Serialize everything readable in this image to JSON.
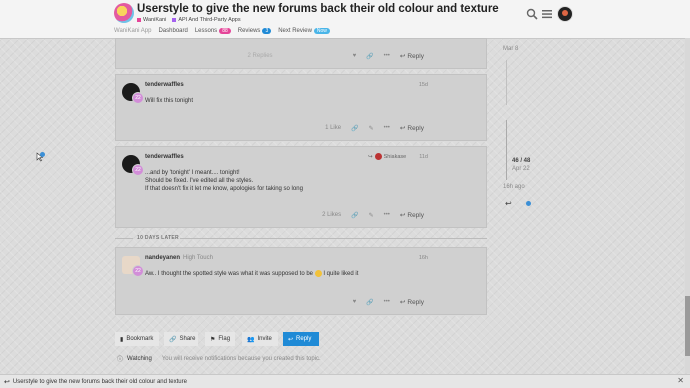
{
  "header": {
    "title": "Userstyle to give the new forums back their old colour and texture",
    "categories": [
      {
        "label": "WaniKani",
        "color": "#e54599"
      },
      {
        "label": "API And Third-Party Apps",
        "color": "#a461ef"
      }
    ],
    "nav": {
      "app": "WaniKani App",
      "dashboard": "Dashboard",
      "lessons": "Lessons",
      "lessons_count": "88",
      "reviews": "Reviews",
      "reviews_count": "3",
      "next_review": "Next Review",
      "next_review_badge": "Now"
    }
  },
  "posts": [
    {
      "actions": {
        "replies": "2 Replies",
        "reply": "Reply"
      }
    },
    {
      "username": "tenderwaffles",
      "level": "22",
      "date": "15d",
      "body": [
        "Will fix this tonight"
      ],
      "likes": "1 Like",
      "reply": "Reply"
    },
    {
      "username": "tenderwaffles",
      "level": "22",
      "date": "11d",
      "reply_to": "Shiakase",
      "body": [
        "...and by 'tonight' I meant.... tonight!",
        "Should be fixed. I've edited all the styles.",
        "If that doesn't fix it let me know, apologies for taking so long"
      ],
      "likes": "2 Likes",
      "reply": "Reply"
    },
    {
      "username": "nandeyanen",
      "user_title": "High Touch",
      "level": "22",
      "date": "16h",
      "body_pre": "Aw.. I thought the spotted style was what it was supposed to be",
      "body_post": "I quite liked it",
      "reply": "Reply"
    }
  ],
  "time_gap": "10 DAYS LATER",
  "bottom_buttons": {
    "bookmark": "Bookmark",
    "share": "Share",
    "flag": "Flag",
    "invite": "Invite",
    "reply": "Reply"
  },
  "watching": {
    "label": "Watching",
    "hint": "You will receive notifications because you created this topic."
  },
  "timeline": {
    "top_date": "Mar 8",
    "count": "46 / 48",
    "date": "Apr 22",
    "ago": "16h ago"
  },
  "footer": {
    "text": "Userstyle to give the new forums back their old colour and texture"
  },
  "colors": {
    "accent": "#1f8ad6",
    "level_badge": "#d28ed8"
  }
}
